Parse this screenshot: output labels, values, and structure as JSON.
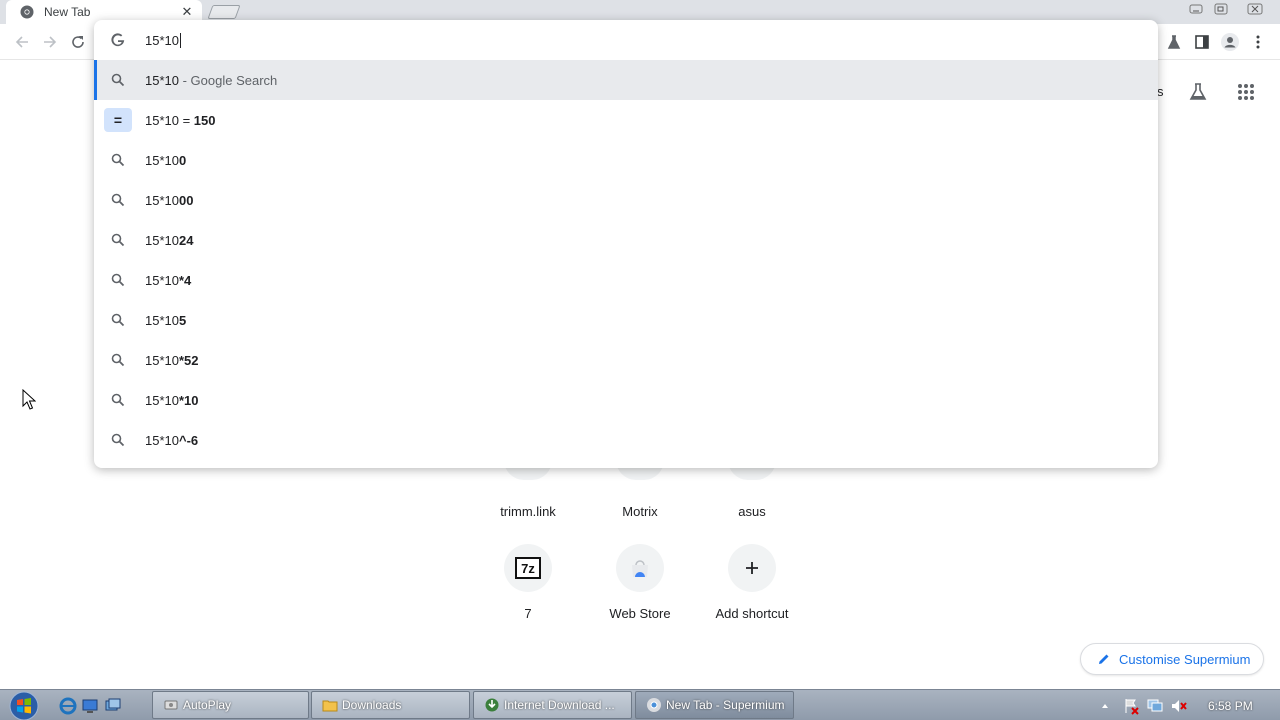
{
  "tab": {
    "title": "New Tab"
  },
  "omnibox": {
    "input_value": "15*10",
    "suggestions": [
      {
        "plain": "15*10",
        "bold": "",
        "suffix": " - Google Search"
      },
      {
        "plain": "15*10 = ",
        "bold": "150",
        "suffix": ""
      },
      {
        "plain": "15*10",
        "bold": "0",
        "suffix": ""
      },
      {
        "plain": "15*10",
        "bold": "00",
        "suffix": ""
      },
      {
        "plain": "15*10",
        "bold": "24",
        "suffix": ""
      },
      {
        "plain": "15*10",
        "bold": "*4",
        "suffix": ""
      },
      {
        "plain": "15*10",
        "bold": "5",
        "suffix": ""
      },
      {
        "plain": "15*10",
        "bold": "*52",
        "suffix": ""
      },
      {
        "plain": "15*10",
        "bold": "*10",
        "suffix": ""
      },
      {
        "plain": "15*10",
        "bold": "^-6",
        "suffix": ""
      }
    ]
  },
  "page": {
    "partial_text": "s",
    "shortcuts_row1": [
      {
        "label": "trimm.link"
      },
      {
        "label": "Motrix"
      },
      {
        "label": "asus"
      }
    ],
    "shortcuts_row2": [
      {
        "label": "7",
        "icon": "7z-icon"
      },
      {
        "label": "Web Store",
        "icon": "web-store-icon"
      },
      {
        "label": "Add shortcut",
        "icon": "plus-icon"
      }
    ],
    "customise_label": "Customise Supermium"
  },
  "taskbar": {
    "items": [
      {
        "label": "AutoPlay"
      },
      {
        "label": "Downloads"
      },
      {
        "label": "Internet Download ..."
      },
      {
        "label": "New Tab - Supermium"
      }
    ],
    "clock": "6:58 PM"
  },
  "colors": {
    "accent": "#1a73e8",
    "selection": "#e8eaed"
  }
}
